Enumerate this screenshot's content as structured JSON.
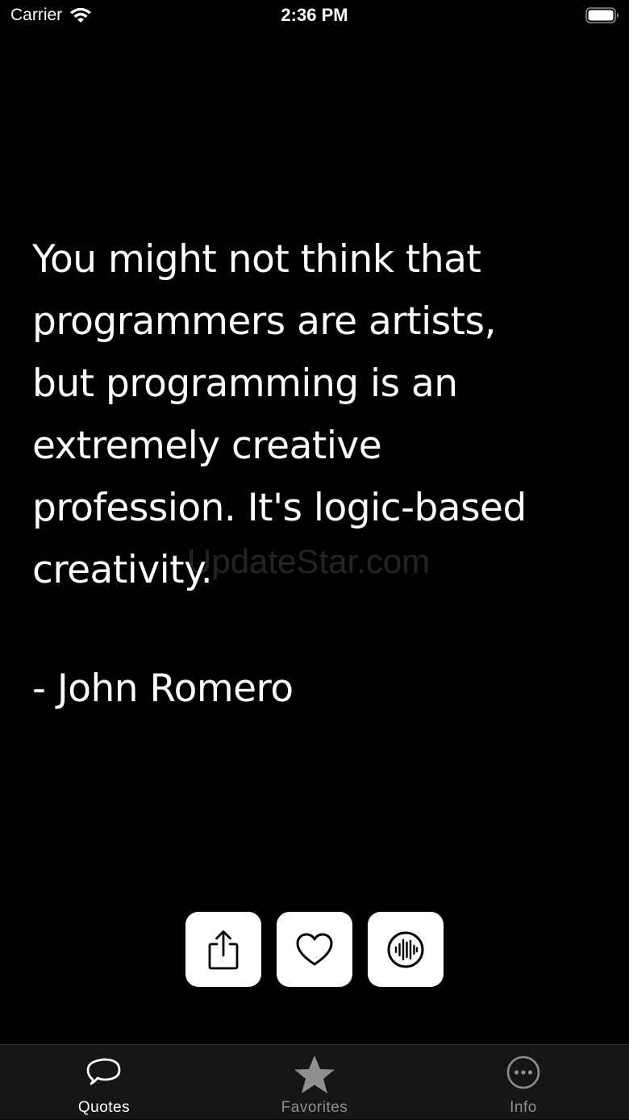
{
  "status_bar": {
    "carrier": "Carrier",
    "time": "2:36 PM",
    "wifi_icon": "wifi-icon",
    "battery_icon": "battery-icon"
  },
  "quote": {
    "text": "You might not think that\nprogrammers are artists,\nbut programming is an\nextremely creative\nprofession. It's logic-based\ncreativity.",
    "author": "- John Romero",
    "watermark": "UpdateStar.com"
  },
  "actions": [
    {
      "name": "share",
      "icon": "share-icon"
    },
    {
      "name": "favorite",
      "icon": "heart-icon"
    },
    {
      "name": "speak",
      "icon": "audio-waveform-icon"
    }
  ],
  "tab_bar": {
    "tabs": [
      {
        "label": "Quotes",
        "icon": "quote-bubble-icon",
        "selected": true
      },
      {
        "label": "Favorites",
        "icon": "star-icon",
        "selected": false
      },
      {
        "label": "Info",
        "icon": "more-circle-icon",
        "selected": false
      }
    ]
  },
  "colors": {
    "background": "#000000",
    "text": "#ffffff",
    "tab_bar": "#161616",
    "tab_selected": "#ffffff",
    "tab_unselected": "#8e8e93",
    "button_bg": "#ffffff"
  }
}
